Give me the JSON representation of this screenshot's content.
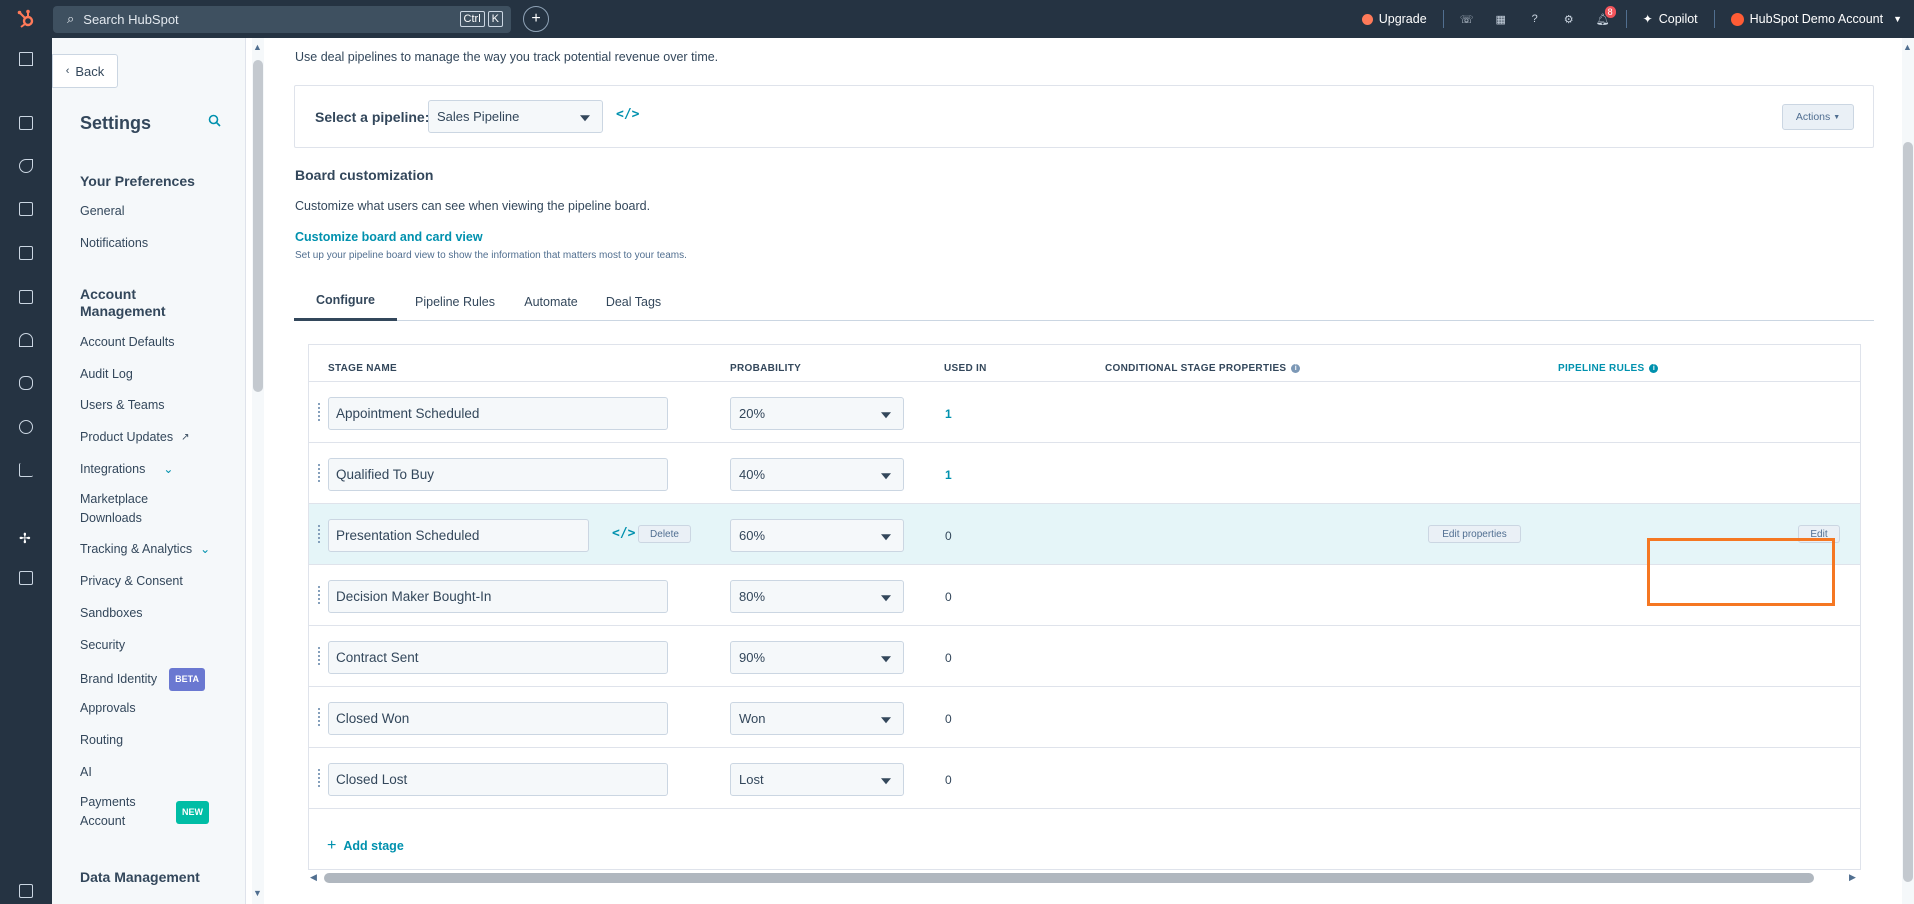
{
  "topbar": {
    "search_placeholder": "Search HubSpot",
    "kbd": [
      "Ctrl",
      "K"
    ],
    "upgrade": "Upgrade",
    "copilot": "Copilot",
    "account": "HubSpot Demo Account",
    "notification_count": "8"
  },
  "settings": {
    "back": "Back",
    "title": "Settings",
    "groups": {
      "preferences": "Your Preferences",
      "account": "Account Management",
      "data": "Data Management"
    },
    "items": {
      "general": "General",
      "notifications": "Notifications",
      "account_defaults": "Account Defaults",
      "audit_log": "Audit Log",
      "users_teams": "Users & Teams",
      "product_updates": "Product Updates",
      "integrations": "Integrations",
      "marketplace": "Marketplace Downloads",
      "tracking": "Tracking & Analytics",
      "privacy": "Privacy & Consent",
      "sandboxes": "Sandboxes",
      "security": "Security",
      "brand_identity": "Brand Identity",
      "brand_tag": "BETA",
      "approvals": "Approvals",
      "routing": "Routing",
      "ai": "AI",
      "payments": "Payments Account",
      "payments_tag": "NEW"
    }
  },
  "main": {
    "intro": "Use deal pipelines to manage the way you track potential revenue over time.",
    "pipeline_label": "Select a pipeline:",
    "pipeline_value": "Sales Pipeline",
    "actions": "Actions",
    "board_title": "Board customization",
    "board_desc": "Customize what users can see when viewing the pipeline board.",
    "board_link": "Customize board and card view",
    "board_sub": "Set up your pipeline board view to show the information that matters most to your teams.",
    "tabs": [
      "Configure",
      "Pipeline Rules",
      "Automate",
      "Deal Tags"
    ],
    "columns": {
      "stage": "STAGE NAME",
      "probability": "PROBABILITY",
      "used": "USED IN",
      "conditional": "CONDITIONAL STAGE PROPERTIES",
      "rules": "PIPELINE RULES"
    },
    "stages": [
      {
        "name": "Appointment Scheduled",
        "probability": "20%",
        "used": "1"
      },
      {
        "name": "Qualified To Buy",
        "probability": "40%",
        "used": "1"
      },
      {
        "name": "Presentation Scheduled",
        "probability": "60%",
        "used": "0"
      },
      {
        "name": "Decision Maker Bought-In",
        "probability": "80%",
        "used": "0"
      },
      {
        "name": "Contract Sent",
        "probability": "90%",
        "used": "0"
      },
      {
        "name": "Closed Won",
        "probability": "Won",
        "used": "0"
      },
      {
        "name": "Closed Lost",
        "probability": "Lost",
        "used": "0"
      }
    ],
    "delete_label": "Delete",
    "edit_properties": "Edit properties",
    "edit": "Edit",
    "add_stage": "Add stage"
  },
  "colors": {
    "nav_bg": "#253342",
    "accent": "#0091ae",
    "highlight": "#f57722",
    "beta_tag": "#6a78d1",
    "new_tag": "#00bda5"
  }
}
